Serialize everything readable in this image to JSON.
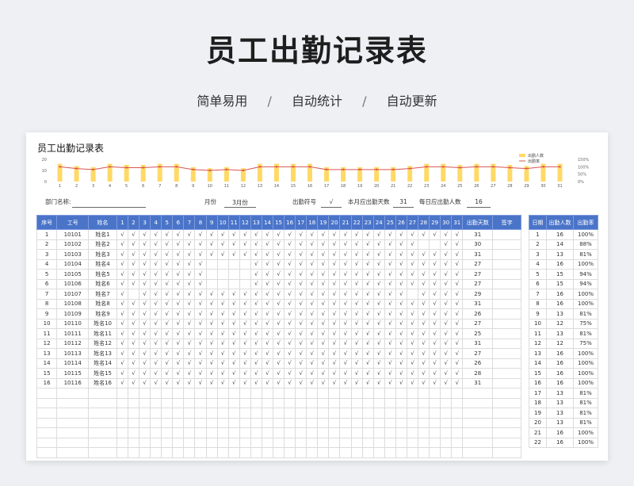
{
  "hero": {
    "title": "员工出勤记录表",
    "subtitle_items": [
      "简单易用",
      "自动统计",
      "自动更新"
    ],
    "separator": "/"
  },
  "sheet": {
    "title": "员工出勤记录表",
    "info": {
      "dept_label": "部门名称:",
      "month_label": "月份",
      "month_value": "3月份",
      "symbol_label": "出勤符号",
      "symbol_value": "√",
      "days_label": "本月应出勤天数",
      "days_value": "31",
      "people_label": "每日应出勤人数",
      "people_value": "16"
    }
  },
  "colors": {
    "header_blue": "#4a74c8",
    "bar_yellow": "#ffd966",
    "line_red": "#d9534f"
  },
  "chart_data": {
    "type": "bar",
    "x": [
      1,
      2,
      3,
      4,
      5,
      6,
      7,
      8,
      9,
      10,
      11,
      12,
      13,
      14,
      15,
      16,
      17,
      18,
      19,
      20,
      21,
      22,
      23,
      24,
      25,
      26,
      27,
      28,
      29,
      30,
      31
    ],
    "series": [
      {
        "name": "出勤人数",
        "type": "bar",
        "values": [
          16,
          14,
          13,
          16,
          15,
          15,
          16,
          16,
          13,
          12,
          13,
          12,
          16,
          16,
          16,
          16,
          13,
          13,
          13,
          13,
          13,
          14,
          16,
          16,
          15,
          16,
          16,
          15,
          14,
          16,
          16
        ]
      },
      {
        "name": "出勤率",
        "type": "line",
        "values": [
          100,
          88,
          81,
          100,
          94,
          94,
          100,
          100,
          81,
          75,
          81,
          75,
          100,
          100,
          100,
          100,
          81,
          81,
          81,
          81,
          81,
          88,
          100,
          100,
          94,
          100,
          100,
          94,
          88,
          100,
          100
        ]
      }
    ],
    "right_ticks": [
      "150%",
      "100%",
      "50%",
      "0%"
    ],
    "left_ticks": [
      "20",
      "10",
      "0"
    ],
    "legend_position": "top-right"
  },
  "table": {
    "headers": {
      "seq": "序号",
      "id": "工号",
      "name": "姓名",
      "total": "出勤天数",
      "sign": "签字"
    },
    "days": [
      "1",
      "2",
      "3",
      "4",
      "5",
      "6",
      "7",
      "8",
      "9",
      "10",
      "11",
      "12",
      "13",
      "14",
      "15",
      "16",
      "17",
      "18",
      "19",
      "20",
      "21",
      "22",
      "23",
      "24",
      "25",
      "26",
      "27",
      "28",
      "29",
      "30",
      "31"
    ],
    "rows": [
      {
        "seq": "1",
        "id": "10101",
        "name": "姓名1",
        "marks": "1111111111111111111111111111111",
        "total": "31"
      },
      {
        "seq": "2",
        "id": "10102",
        "name": "姓名2",
        "marks": "1111111111111111111111111110011",
        "total": "30"
      },
      {
        "seq": "3",
        "id": "10103",
        "name": "姓名3",
        "marks": "1111111111111111111111111111111",
        "total": "31"
      },
      {
        "seq": "4",
        "id": "10104",
        "name": "姓名4",
        "marks": "1111111100001111111111111111111",
        "total": "27"
      },
      {
        "seq": "5",
        "id": "10105",
        "name": "姓名5",
        "marks": "1111111100001111111111111111111",
        "total": "27"
      },
      {
        "seq": "6",
        "id": "10106",
        "name": "姓名6",
        "marks": "1111111100001111111111111111111",
        "total": "27"
      },
      {
        "seq": "7",
        "id": "10107",
        "name": "姓名7",
        "marks": "1011111111111111111111111101111",
        "total": "29"
      },
      {
        "seq": "8",
        "id": "10108",
        "name": "姓名8",
        "marks": "1111111111111111111111111111111",
        "total": "31"
      },
      {
        "seq": "9",
        "id": "10109",
        "name": "姓名9",
        "marks": "1111111111111111111111111111111",
        "total": "26"
      },
      {
        "seq": "10",
        "id": "10110",
        "name": "姓名10",
        "marks": "1111111111111111111111111111111",
        "total": "27"
      },
      {
        "seq": "11",
        "id": "10111",
        "name": "姓名11",
        "marks": "1111111111111111111111111111111",
        "total": "25"
      },
      {
        "seq": "12",
        "id": "10112",
        "name": "姓名12",
        "marks": "1111111111111111111111111111111",
        "total": "31"
      },
      {
        "seq": "13",
        "id": "10113",
        "name": "姓名13",
        "marks": "1111111111111111111111111111111",
        "total": "27"
      },
      {
        "seq": "14",
        "id": "10114",
        "name": "姓名14",
        "marks": "1111111111111111111111111111111",
        "total": "26"
      },
      {
        "seq": "15",
        "id": "10115",
        "name": "姓名15",
        "marks": "1111111111111111111111111111111",
        "total": "28"
      },
      {
        "seq": "16",
        "id": "10116",
        "name": "姓名16",
        "marks": "1111111111111111111111111111111",
        "total": "31"
      }
    ],
    "blank_rows": 7
  },
  "side_table": {
    "headers": {
      "day": "日期",
      "count": "出勤人数",
      "rate": "出勤率"
    },
    "rows": [
      {
        "day": "1",
        "count": "16",
        "rate": "100%"
      },
      {
        "day": "2",
        "count": "14",
        "rate": "88%"
      },
      {
        "day": "3",
        "count": "13",
        "rate": "81%"
      },
      {
        "day": "4",
        "count": "16",
        "rate": "100%"
      },
      {
        "day": "5",
        "count": "15",
        "rate": "94%"
      },
      {
        "day": "6",
        "count": "15",
        "rate": "94%"
      },
      {
        "day": "7",
        "count": "16",
        "rate": "100%"
      },
      {
        "day": "8",
        "count": "16",
        "rate": "100%"
      },
      {
        "day": "9",
        "count": "13",
        "rate": "81%"
      },
      {
        "day": "10",
        "count": "12",
        "rate": "75%"
      },
      {
        "day": "11",
        "count": "13",
        "rate": "81%"
      },
      {
        "day": "12",
        "count": "12",
        "rate": "75%"
      },
      {
        "day": "13",
        "count": "16",
        "rate": "100%"
      },
      {
        "day": "14",
        "count": "16",
        "rate": "100%"
      },
      {
        "day": "15",
        "count": "16",
        "rate": "100%"
      },
      {
        "day": "16",
        "count": "16",
        "rate": "100%"
      },
      {
        "day": "17",
        "count": "13",
        "rate": "81%"
      },
      {
        "day": "18",
        "count": "13",
        "rate": "81%"
      },
      {
        "day": "19",
        "count": "13",
        "rate": "81%"
      },
      {
        "day": "20",
        "count": "13",
        "rate": "81%"
      },
      {
        "day": "21",
        "count": "16",
        "rate": "100%"
      },
      {
        "day": "22",
        "count": "16",
        "rate": "100%"
      }
    ]
  }
}
